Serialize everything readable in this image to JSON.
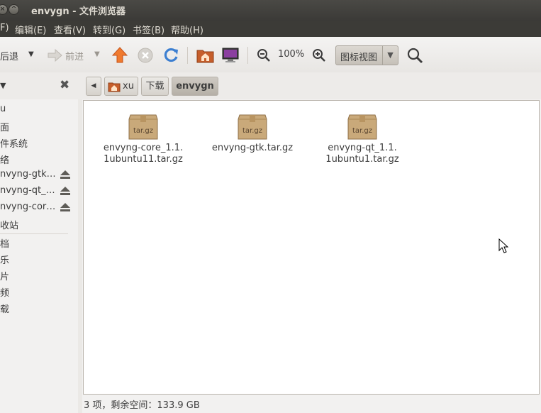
{
  "window": {
    "title": "envygn - 文件浏览器"
  },
  "menubar": {
    "items": [
      "F)",
      "编辑(E)",
      "查看(V)",
      "转到(G)",
      "书签(B)",
      "帮助(H)"
    ]
  },
  "toolbar": {
    "back_label": "后退",
    "forward_label": "前进",
    "zoom_level": "100%",
    "view_mode": "图标视图"
  },
  "breadcrumbs": [
    "xu",
    "下载",
    "envygn"
  ],
  "sidebar": {
    "items": [
      {
        "label": "u"
      },
      {
        "label": "面"
      },
      {
        "label": "件系统"
      },
      {
        "label": "络"
      },
      {
        "label": "nvyng-gtk…"
      },
      {
        "label": "nvyng-qt_…"
      },
      {
        "label": "nvyng-cor…"
      },
      {
        "label": "收站"
      },
      {
        "label": "档"
      },
      {
        "label": "乐"
      },
      {
        "label": "片"
      },
      {
        "label": "频"
      },
      {
        "label": "载"
      }
    ]
  },
  "files": [
    {
      "line1": "envyng-core_1.1.",
      "line2": "1ubuntu11.tar.gz",
      "icon_text": "tar.gz"
    },
    {
      "line1": "envyng-gtk.tar.gz",
      "line2": "",
      "icon_text": "tar.gz"
    },
    {
      "line1": "envyng-qt_1.1.",
      "line2": "1ubuntu1.tar.gz",
      "icon_text": "tar.gz"
    }
  ],
  "status": {
    "text": "3 项，剩余空间：133.9 GB"
  },
  "colors": {
    "titlebar": "#3c3b37",
    "accent_orange": "#e95420",
    "package_brown": "#c9a97a"
  }
}
